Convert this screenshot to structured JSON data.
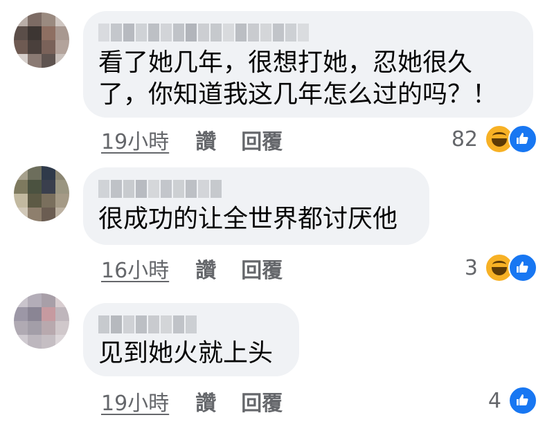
{
  "comments": [
    {
      "text_lines": [
        "看了她几年，很想打她，忍她很久",
        "了，你知道我这几年怎么过的吗？！"
      ],
      "time": "19小時",
      "like_label": "讚",
      "reply_label": "回覆",
      "reaction_count": "82",
      "reactions": [
        "haha-icon",
        "like-icon"
      ]
    },
    {
      "text_lines": [
        "很成功的让全世界都讨厌他"
      ],
      "time": "16小時",
      "like_label": "讚",
      "reply_label": "回覆",
      "reaction_count": "3",
      "reactions": [
        "haha-icon",
        "like-icon"
      ]
    },
    {
      "text_lines": [
        "见到她火就上头"
      ],
      "time": "19小時",
      "like_label": "讚",
      "reply_label": "回覆",
      "reaction_count": "4",
      "reactions": [
        "like-icon"
      ]
    }
  ],
  "colors": {
    "bubble_bg": "#f0f2f5",
    "meta_text": "#65676b",
    "like_blue": "#1877f2",
    "haha_yellow": "#f7b125"
  }
}
